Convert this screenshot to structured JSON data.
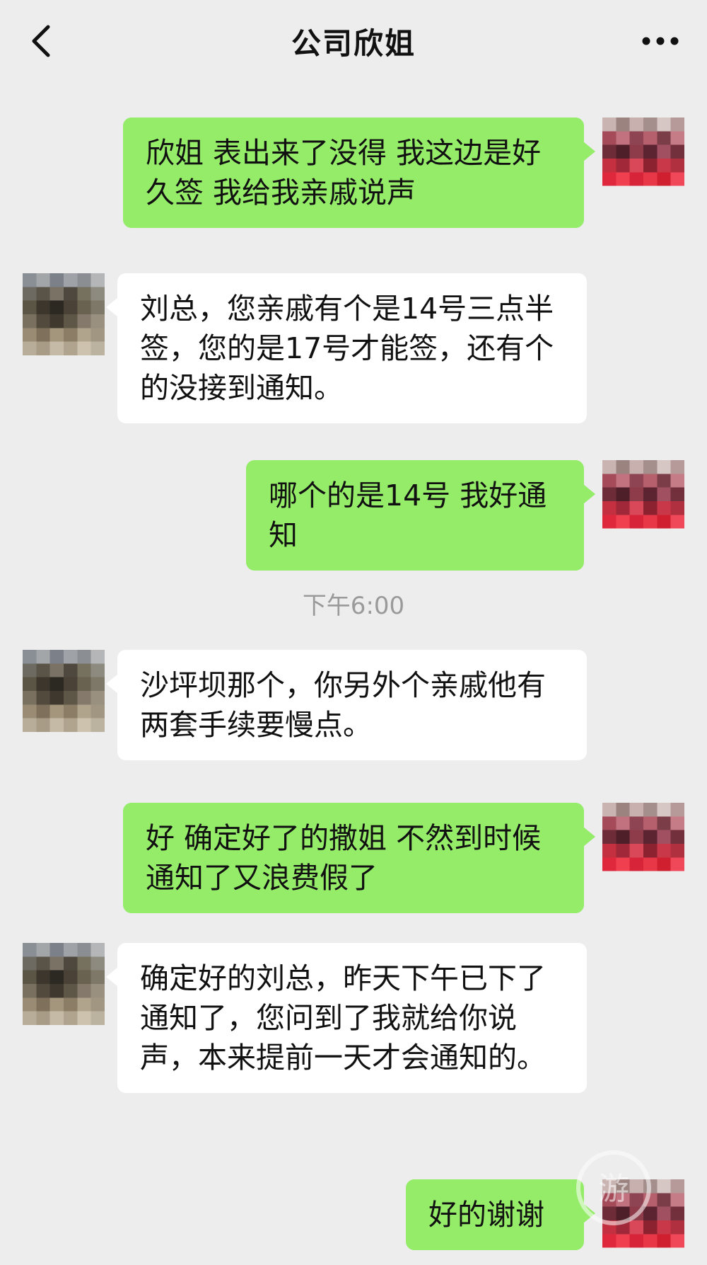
{
  "header": {
    "title": "公司欣姐",
    "back_icon": "chevron-left-icon",
    "more_icon": "more-dots-icon"
  },
  "timestamp": "下午6:00",
  "messages": [
    {
      "side": "mine",
      "text": "欣姐 表出来了没得 我这边是好久签 我给我亲戚说声"
    },
    {
      "side": "theirs",
      "text": "刘总，您亲戚有个是14号三点半签，您的是17号才能签，还有个的没接到通知。"
    },
    {
      "side": "mine",
      "text": "哪个的是14号 我好通知"
    },
    {
      "side": "theirs",
      "text": "沙坪坝那个，你另外个亲戚他有两套手续要慢点。"
    },
    {
      "side": "mine",
      "text": "好 确定好了的撒姐 不然到时候通知了又浪费假了"
    },
    {
      "side": "theirs",
      "text": "确定好的刘总，昨天下午已下了通知了，您问到了我就给你说声，本来提前一天才会通知的。"
    },
    {
      "side": "mine",
      "text": "好的谢谢"
    }
  ],
  "watermark": {
    "text": "游"
  },
  "colors": {
    "background": "#ededed",
    "mine_bubble": "#95ec69",
    "theirs_bubble": "#ffffff",
    "timestamp": "#9a9a9a"
  }
}
